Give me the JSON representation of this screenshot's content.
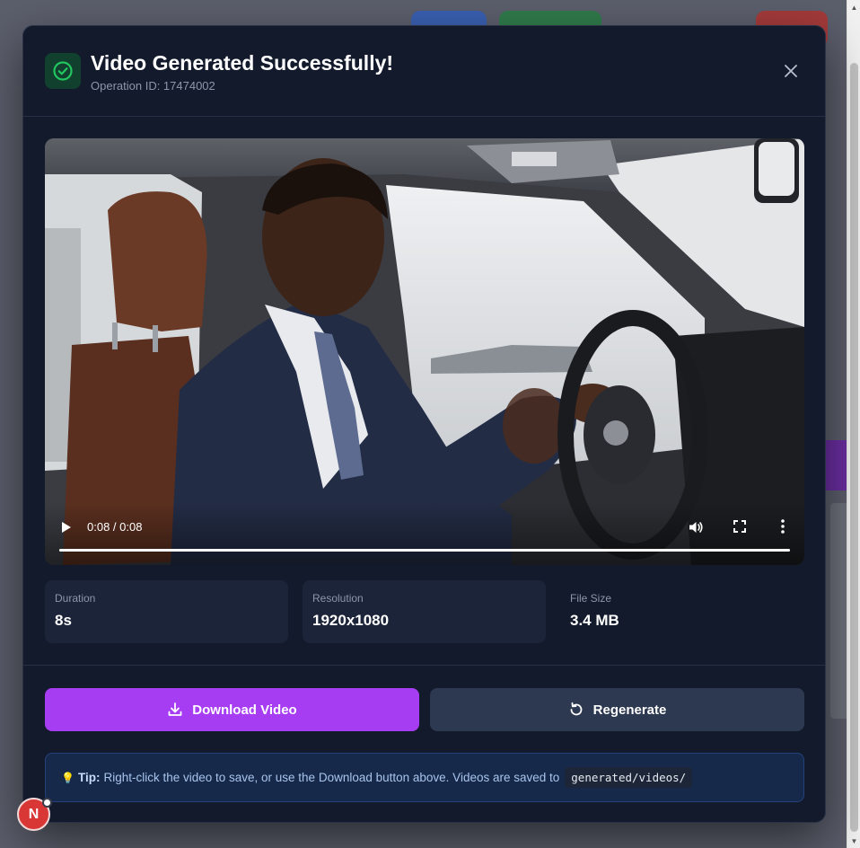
{
  "modal": {
    "title": "Video Generated Successfully!",
    "operation_id": "Operation ID: 17474002",
    "close_icon": "close-icon",
    "success_icon": "check-circle-icon",
    "accent_success": "#22c55e"
  },
  "video": {
    "time": "0:08 / 0:08",
    "progress": 1.0,
    "play_icon": "play-icon",
    "volume_icon": "volume-icon",
    "fullscreen_icon": "fullscreen-icon",
    "more_icon": "more-vertical-icon"
  },
  "stats": [
    {
      "label": "Duration",
      "value": "8s"
    },
    {
      "label": "Resolution",
      "value": "1920x1080"
    },
    {
      "label": "File Size",
      "value": "3.4 MB"
    }
  ],
  "actions": {
    "download_label": "Download Video",
    "download_icon": "download-icon",
    "download_color": "#a73df2",
    "regenerate_label": "Regenerate",
    "regenerate_icon": "refresh-icon"
  },
  "tip": {
    "icon": "lightbulb-icon",
    "label": "Tip:",
    "text": "Right-click the video to save, or use the Download button above. Videos are saved to",
    "path": "generated/videos/"
  },
  "avatar": {
    "initial": "N"
  }
}
